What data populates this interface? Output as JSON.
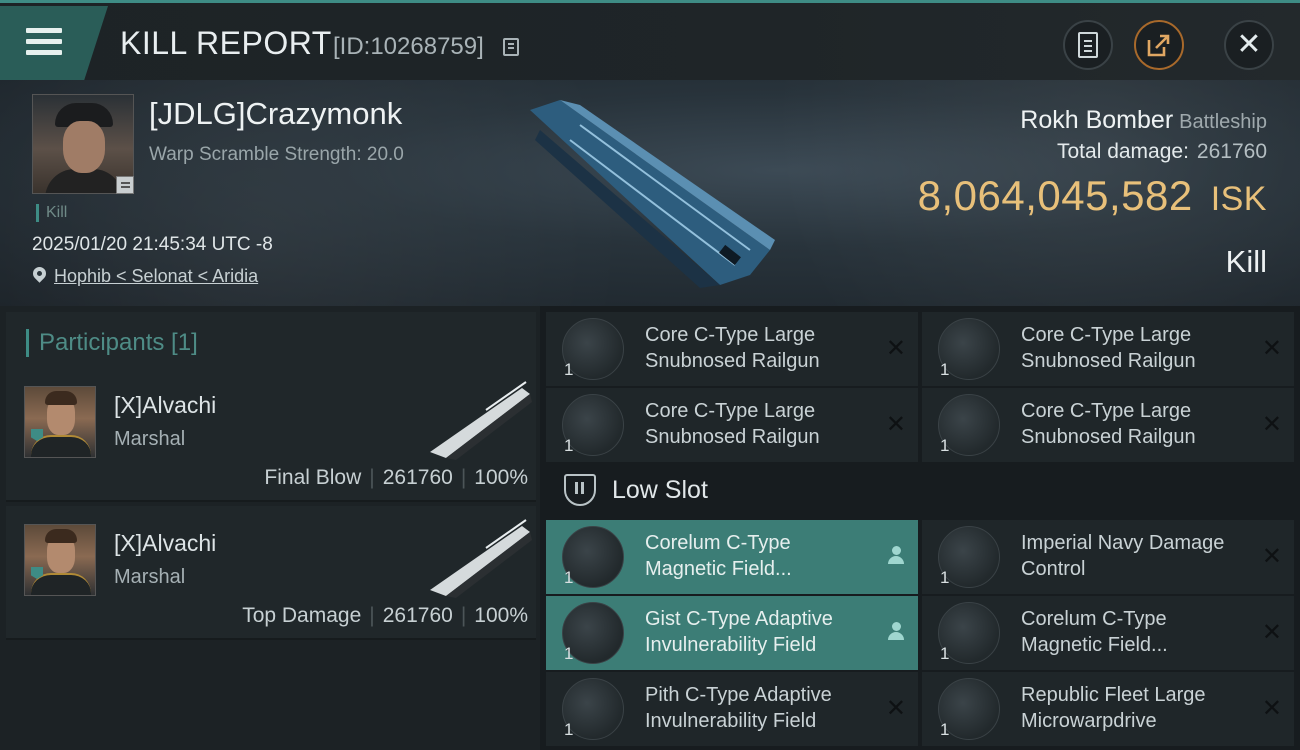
{
  "header": {
    "title": "KILL REPORT",
    "report_id": "[ID:10268759]",
    "icons": [
      "menu-icon",
      "copy-icon",
      "clipboard-icon",
      "share-icon",
      "close-icon"
    ]
  },
  "victim": {
    "name": "[JDLG]Crazymonk",
    "warp_scramble": "Warp Scramble Strength: 20.0",
    "kill_label": "Kill",
    "datetime": "2025/01/20 21:45:34 UTC -8",
    "location": "Hophib < Selonat < Aridia",
    "ship_name": "Rokh Bomber",
    "ship_class": "Battleship",
    "total_damage_label": "Total damage:",
    "total_damage": "261760",
    "isk_value": "8,064,045,582",
    "isk_unit": "ISK",
    "outcome": "Kill"
  },
  "participants": {
    "heading": "Participants [1]",
    "items": [
      {
        "name": "[X]Alvachi",
        "ship": "Marshal",
        "role": "Final Blow",
        "damage": "261760",
        "percent": "100%"
      },
      {
        "name": "[X]Alvachi",
        "ship": "Marshal",
        "role": "Top Damage",
        "damage": "261760",
        "percent": "100%"
      }
    ]
  },
  "fitting": {
    "high_slots": [
      {
        "name": "Core C-Type Large Snubnosed Railgun",
        "qty": "1"
      },
      {
        "name": "Core C-Type Large Snubnosed Railgun",
        "qty": "1"
      },
      {
        "name": "Core C-Type Large Snubnosed Railgun",
        "qty": "1"
      },
      {
        "name": "Core C-Type Large Snubnosed Railgun",
        "qty": "1"
      }
    ],
    "low_slot_label": "Low Slot",
    "low_slots": [
      {
        "name": "Corelum C-Type Magnetic Field...",
        "qty": "1",
        "status": "dropped"
      },
      {
        "name": "Imperial Navy Damage Control",
        "qty": "1",
        "status": "destroyed"
      },
      {
        "name": "Gist C-Type Adaptive Invulnerability Field",
        "qty": "1",
        "status": "dropped"
      },
      {
        "name": "Corelum C-Type Magnetic Field...",
        "qty": "1",
        "status": "destroyed"
      },
      {
        "name": "Pith C-Type Adaptive Invulnerability Field",
        "qty": "1",
        "status": "destroyed"
      },
      {
        "name": "Republic Fleet Large Microwarpdrive",
        "qty": "1",
        "status": "destroyed"
      }
    ]
  },
  "colors": {
    "accent": "#3e8c85",
    "isk": "#e8c07a",
    "highlight_row": "#3c7d76"
  }
}
